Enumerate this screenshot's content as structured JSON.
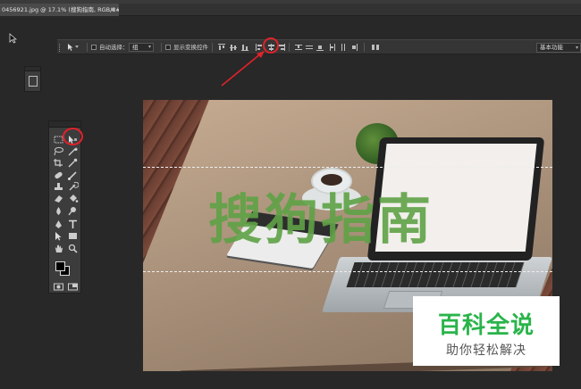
{
  "tab": {
    "title": "0456921.jpg @ 17.1% (搜狗指南, RGB/8#) *",
    "close": "×"
  },
  "options_bar": {
    "auto_select_label": "自动选择：",
    "auto_select_value": "组",
    "show_transform_label": "显示变换控件",
    "workspace_value": "基本功能"
  },
  "canvas": {
    "watermark_text": "搜狗指南"
  },
  "brand": {
    "title": "百科全说",
    "slogan": "助你轻松解决"
  },
  "colors": {
    "annotation": "#e0222a",
    "watermark": "#5fa246",
    "brand_green": "#2ab44a",
    "foreground": "#000000",
    "background": "#000000"
  }
}
